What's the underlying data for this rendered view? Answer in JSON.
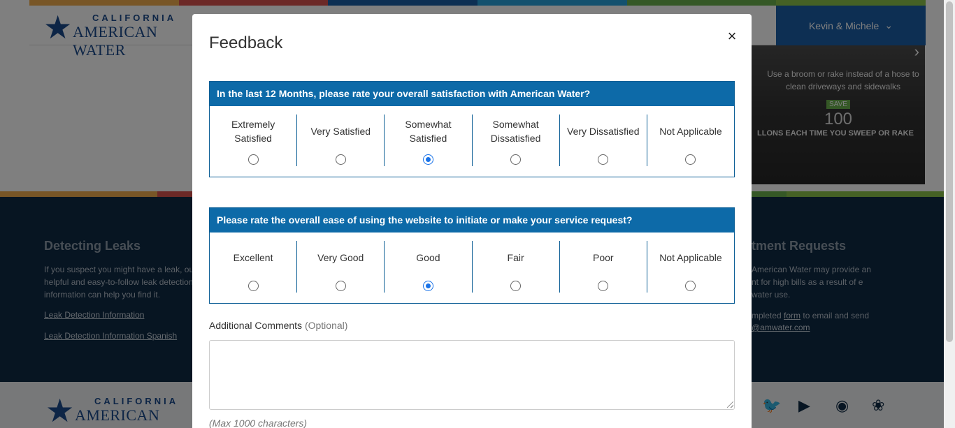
{
  "background": {
    "logo_small": "CALIFORNIA",
    "logo_big": "AMERICAN WATER",
    "user_menu": "Kevin & Michele",
    "promo": {
      "tip": "Use a broom or rake instead of a hose to clean driveways and sidewalks",
      "save": "SAVE",
      "number": "100",
      "unit": "LLONS EACH TIME YOU SWEEP OR RAKE"
    },
    "leaks": {
      "title": "Detecting Leaks",
      "text": "If you suspect you might have a leak, our helpful and easy-to-follow leak detection information can help you find it.",
      "link1": "Leak Detection Information",
      "link2": "Leak Detection Information Spanish"
    },
    "adjust": {
      "title": "tment Requests",
      "text": "American Water may provide an nt for high bills as a result of e water use.",
      "text2_pre": "mpleted ",
      "text2_link": "form",
      "text2_post": " to email and send",
      "email": "@amwater.com"
    },
    "stripe_colors": [
      "#f0ad4e",
      "#d9534f",
      "#1a5fa6",
      "#27a3dd",
      "#6ab04c",
      "#8bc34a"
    ]
  },
  "modal": {
    "title": "Feedback",
    "close": "×",
    "questions": [
      {
        "text": "In the last 12 Months, please rate your overall satisfaction with American Water?",
        "options": [
          "Extremely Satisfied",
          "Very Satisfied",
          "Somewhat Satisfied",
          "Somewhat Dissatisfied",
          "Very Dissatisfied",
          "Not Applicable"
        ],
        "selected": "Somewhat Satisfied"
      },
      {
        "text": "Please rate the overall ease of using the website to initiate or make your service request?",
        "options": [
          "Excellent",
          "Very Good",
          "Good",
          "Fair",
          "Poor",
          "Not Applicable"
        ],
        "selected": "Good"
      }
    ],
    "comments_label": "Additional Comments",
    "comments_optional": "(Optional)",
    "comments_value": "",
    "max_chars": "(Max 1000 characters)"
  }
}
